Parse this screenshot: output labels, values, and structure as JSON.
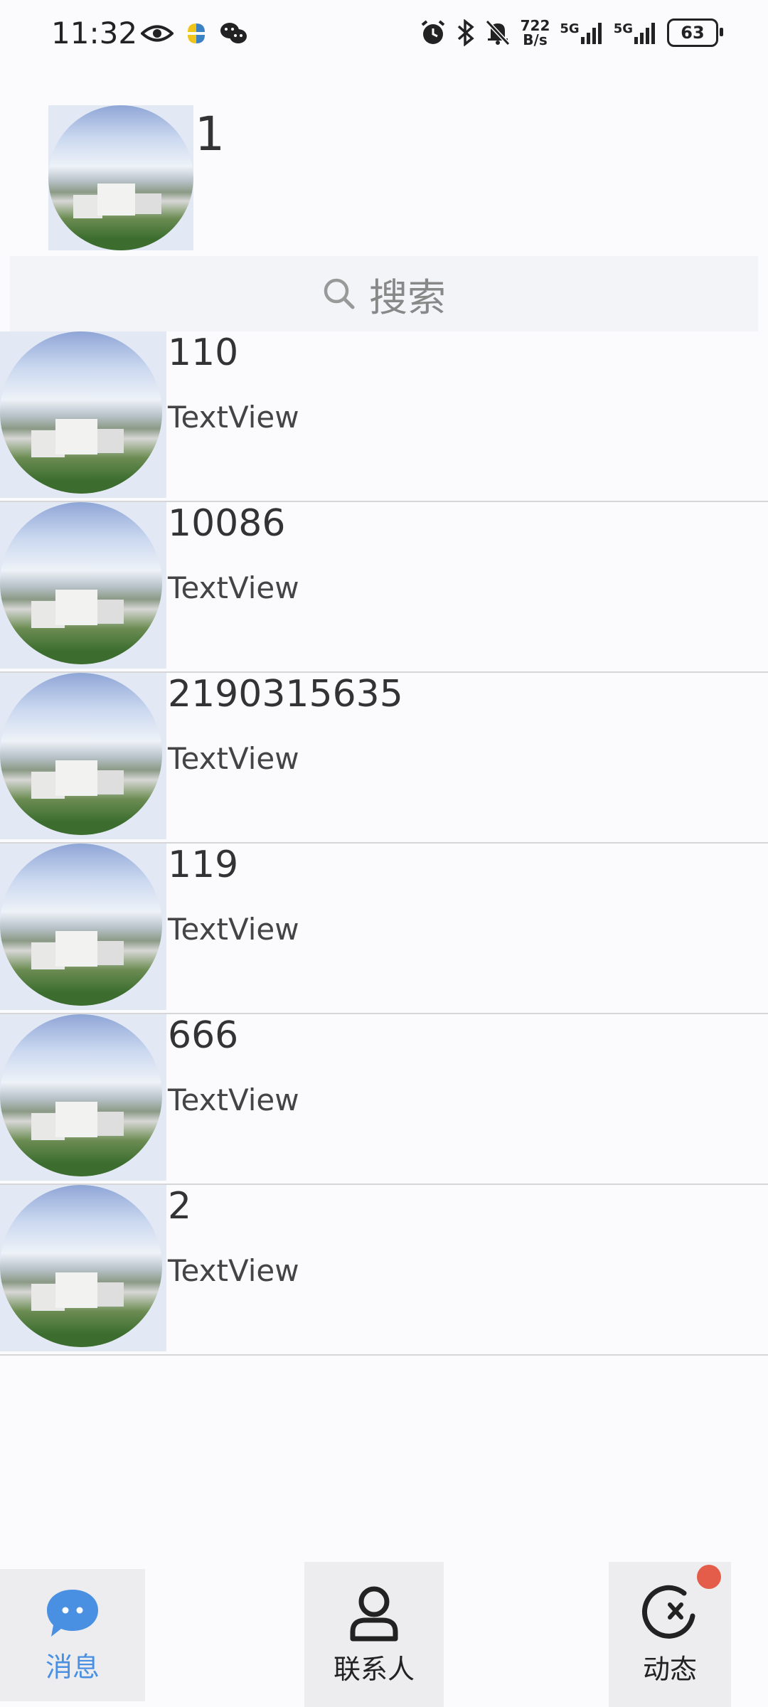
{
  "status_bar": {
    "time": "11:32",
    "left_icons": [
      "eye-icon",
      "app-icon",
      "wechat-icon"
    ],
    "net_speed_value": "722",
    "net_speed_unit": "B/s",
    "network_1": "5G",
    "network_2": "5G",
    "battery": "63"
  },
  "profile": {
    "name": "1"
  },
  "search": {
    "label": "搜索"
  },
  "contacts": [
    {
      "name": "110",
      "subtitle": "TextView"
    },
    {
      "name": "10086",
      "subtitle": "TextView"
    },
    {
      "name": "2190315635",
      "subtitle": "TextView"
    },
    {
      "name": "119",
      "subtitle": "TextView"
    },
    {
      "name": "666",
      "subtitle": "TextView"
    },
    {
      "name": "2",
      "subtitle": "TextView"
    }
  ],
  "bottom_nav": {
    "messages": "消息",
    "contacts": "联系人",
    "moments": "动态",
    "active_color": "#4a90e2",
    "badge_color": "#e35d4a"
  }
}
